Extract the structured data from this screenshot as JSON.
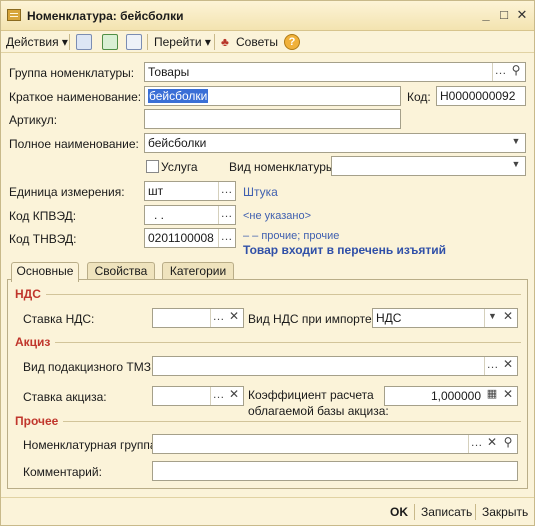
{
  "window": {
    "title": "Номенклатура: бейсболки"
  },
  "toolbar": {
    "actions": "Действия",
    "go": "Перейти",
    "advice": "Советы",
    "help_glyph": "?"
  },
  "form": {
    "group_label": "Группа номенклатуры:",
    "group_value": "Товары",
    "short_name_label": "Краткое наименование:",
    "short_name_value": "бейсболки",
    "code_label": "Код:",
    "code_value": "Н0000000092",
    "article_label": "Артикул:",
    "article_value": "",
    "full_name_label": "Полное наименование:",
    "full_name_value": "бейсболки",
    "service_label": "Услуга",
    "kind_label": "Вид номенклатуры:",
    "kind_value": "",
    "unit_label": "Единица измерения:",
    "unit_value": "шт",
    "unit_link": "Штука",
    "kpved_label": "Код КПВЭД:",
    "kpved_value": ".  .",
    "kpved_link": "<не указано>",
    "tnved_label": "Код ТНВЭД:",
    "tnved_value": "0201100008",
    "tnved_link": "– – прочие; прочие",
    "exempt_notice": "Товар входит в перечень изъятий"
  },
  "tabs": [
    {
      "label": "Основные",
      "active": true
    },
    {
      "label": "Свойства",
      "active": false
    },
    {
      "label": "Категории",
      "active": false
    }
  ],
  "main_tab": {
    "vat_section": "НДС",
    "vat_rate_label": "Ставка НДС:",
    "vat_rate_value": "",
    "vat_import_label": "Вид НДС при импорте:",
    "vat_import_value": "НДС",
    "excise_section": "Акциз",
    "excise_kind_label": "Вид подакцизного ТМЗ:",
    "excise_kind_value": "",
    "excise_rate_label": "Ставка акциза:",
    "excise_rate_value": "",
    "coef_label_1": "Коэффициент расчета",
    "coef_label_2": "облагаемой базы акциза:",
    "coef_value": "1,000000",
    "other_section": "Прочее",
    "nom_group_label": "Номенклатурная группа:",
    "nom_group_value": "",
    "comment_label": "Комментарий:",
    "comment_value": ""
  },
  "bottom": {
    "ok": "OK",
    "save": "Записать",
    "close": "Закрыть"
  },
  "colors": {
    "section_title": "#c0362c",
    "link": "#4060b0",
    "window_bg": "#fbf3d9"
  }
}
